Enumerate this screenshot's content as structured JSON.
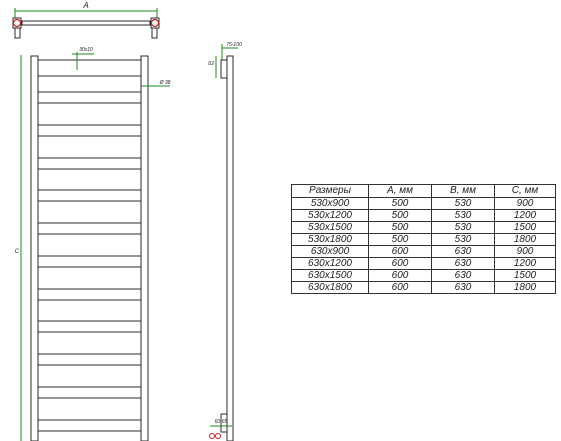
{
  "front_view": {
    "dim_a_label": "A",
    "dim_c_label": "C",
    "tube_label": "30x10",
    "bar_label": "Ø 38"
  },
  "side_view": {
    "offset_label": "75-100",
    "depth_label": "ß2",
    "bottom_label": "60-65"
  },
  "colors": {
    "line": "#2b2b2b",
    "dimension": "#1a8c1a",
    "valve": "#cc2222"
  },
  "size_table": {
    "headers": [
      "Размеры",
      "A, мм",
      "B, мм",
      "C, мм"
    ],
    "rows": [
      [
        "530x900",
        "500",
        "530",
        "900"
      ],
      [
        "530x1200",
        "500",
        "530",
        "1200"
      ],
      [
        "530x1500",
        "500",
        "530",
        "1500"
      ],
      [
        "530x1800",
        "500",
        "530",
        "1800"
      ],
      [
        "630x900",
        "600",
        "630",
        "900"
      ],
      [
        "630x1200",
        "600",
        "630",
        "1200"
      ],
      [
        "630x1500",
        "600",
        "630",
        "1500"
      ],
      [
        "630x1800",
        "600",
        "630",
        "1800"
      ]
    ]
  }
}
